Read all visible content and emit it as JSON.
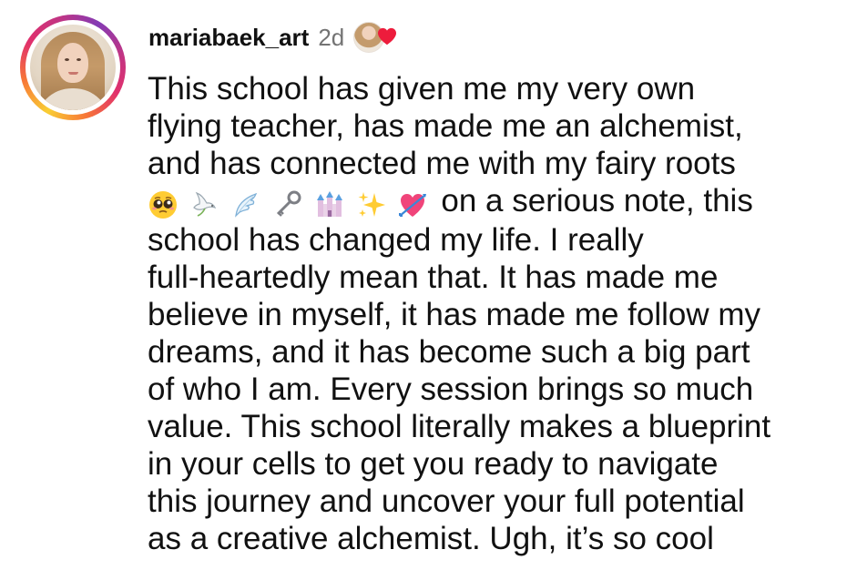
{
  "comment": {
    "username": "mariabaek_art",
    "time_ago": "2d",
    "liked_by_author": true,
    "lines": {
      "l1": "This school has given me my very own",
      "l2": "flying teacher, has made me an alchemist,",
      "l3": "and has connected me with my fairy roots",
      "l4_emojis": [
        "pleading-face",
        "dove",
        "wing",
        "old-key",
        "castle",
        "sparkles",
        "heart-with-arrow"
      ],
      "l4": "on a serious note, this",
      "l5": "school has changed my life. I really",
      "l6": "full-heartedly mean that. It has made me",
      "l7": "believe in myself, it has made me follow my",
      "l8": "dreams, and it has become such a big part",
      "l9": "of who I am. Every session brings so much",
      "l10": "value. This school literally makes a blueprint",
      "l11": "in your cells to get you ready to navigate",
      "l12": "this journey and uncover your full potential",
      "l13": "as a creative alchemist. Ugh, it’s so cool"
    }
  },
  "colors": {
    "text": "#111111",
    "muted": "#737373",
    "heart": "#ed1c3c",
    "ring_start": "#f9ce34",
    "ring_mid": "#e1306c",
    "ring_end": "#833ab4"
  }
}
